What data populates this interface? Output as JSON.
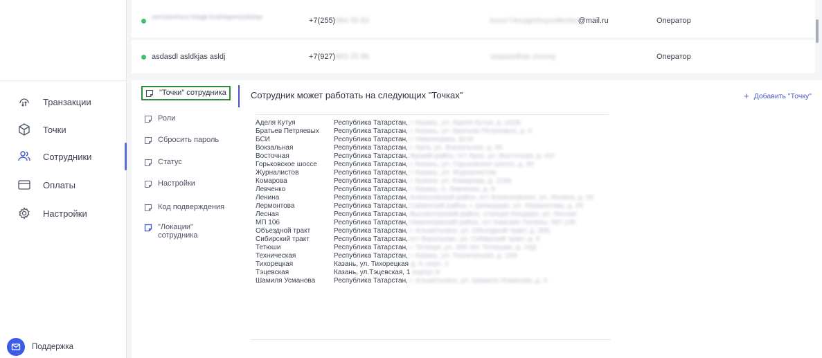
{
  "sidebar": {
    "items": [
      {
        "label": "Транзакции",
        "icon": "transactions-icon"
      },
      {
        "label": "Точки",
        "icon": "box-icon"
      },
      {
        "label": "Сотрудники",
        "icon": "users-icon"
      },
      {
        "label": "Оплаты",
        "icon": "payment-icon"
      },
      {
        "label": "Настройки",
        "icon": "gear-icon"
      }
    ],
    "active_index": 2,
    "support_label": "Поддержка"
  },
  "employees": [
    {
      "name": "yamxylumhwuu khtqgk Ecsjrhkgwmzyskickgc",
      "phone_prefix": "+7(255)",
      "phone_rest": "984 55 63",
      "email_hidden": "kxxvr74ncjqmhvyuntkmbo",
      "email_domain": "@mail.ru",
      "role": "Оператор"
    },
    {
      "name": "asdasdl asldkjas asldj",
      "phone_prefix": "+7(927)",
      "phone_rest": "863 25 86",
      "email_hidden": "ssaasodhac.mxsxq",
      "email_domain": "",
      "role": "Оператор"
    }
  ],
  "tabs": [
    {
      "label": "\"Точки\" сотрудника",
      "selected": true
    },
    {
      "label": "Роли"
    },
    {
      "label": "Сбросить пароль"
    },
    {
      "label": "Статус"
    },
    {
      "label": "Настройки"
    },
    {
      "label": "Код подверждения"
    },
    {
      "label": "\"Локации\" сотрудника"
    }
  ],
  "detail": {
    "title": "Сотрудник может работать на следующих \"Точках\"",
    "add_label": "Добавить \"Точку\""
  },
  "points": [
    {
      "name": "Аделя Кутуя",
      "address": "Республика Татарстан,",
      "hidden": "г. Казань, ул. Аделя Кутуя, д. 161В"
    },
    {
      "name": "Братьев Петряевых",
      "address": "Республика Татарстан,",
      "hidden": "г. Казань, ул. Братьев Петряевых, д. 5"
    },
    {
      "name": "БСИ",
      "address": "Республика Татарстан,",
      "hidden": "г. Нижнекамск, БСИ"
    },
    {
      "name": "Вокзальная",
      "address": "Республика Татарстан,",
      "hidden": "г. Арск, ул. Вокзальная, д. 90"
    },
    {
      "name": "Восточная",
      "address": "Республика Татарстан,",
      "hidden": "Арский район, пгт Арск, ул. Восточная, д. 41Г"
    },
    {
      "name": "Горьковское шоссе",
      "address": "Республика Татарстан,",
      "hidden": "г. Казань, ул. Горьковское шоссе, д. 30"
    },
    {
      "name": "Журналистов",
      "address": "Республика Татарстан,",
      "hidden": "г. Казань, ул. Журналистов"
    },
    {
      "name": "Комарова",
      "address": "Республика Татарстан,",
      "hidden": "г. Буинск, ул. Комарова, д. 115А"
    },
    {
      "name": "Левченко",
      "address": "Республика Татарстан,",
      "hidden": "г. Казань, п. Левченко, д. 9"
    },
    {
      "name": "Ленина",
      "address": "Республика Татарстан,",
      "hidden": "Алексеевский район, пгт Алексеевское, ул. Ленина, д. 50"
    },
    {
      "name": "Лермонтова",
      "address": "Республика Татарстан,",
      "hidden": "Сабинский район, г. Шемордан, ул. Лермонтова, д. 26"
    },
    {
      "name": "Лесная",
      "address": "Республика Татарстан,",
      "hidden": "Высокогорский район, станция Кендари, ул. Лесная"
    },
    {
      "name": "МП 106",
      "address": "Республика Татарстан,",
      "hidden": "Нижнекамский район, пгт Камские Поляны, МП 106"
    },
    {
      "name": "Объездной тракт",
      "address": "Республика Татарстан,",
      "hidden": "г. Альметьевск, ул. Объездной тракт, д. 35Б"
    },
    {
      "name": "Сибирский тракт",
      "address": "Республика Татарстан,",
      "hidden": "пгт Васильево, ул. Сибирский тракт, д. 6"
    },
    {
      "name": "Тетюши",
      "address": "Республика Татарстан,",
      "hidden": "г. Тетюши, ул. 200 лет Тетюшам, д. 14Д"
    },
    {
      "name": "Техническая",
      "address": "Республика Татарстан,",
      "hidden": "г. Казань, ул. Техническая, д. 15А"
    },
    {
      "name": "Тихорецкая",
      "address": "Казань, ул. Тихорецкая",
      "hidden": "д. 6, корп. 2"
    },
    {
      "name": "Тэцевская",
      "address": "Казань, ул.Тэцевская, 1",
      "hidden": "корпус 8"
    },
    {
      "name": "Шамиля Усманова",
      "address": "Республика Татарстан,",
      "hidden": "г. Альметьевск, ул. Шамиля Усманова, д. 3"
    }
  ],
  "colors": {
    "accent": "#3f56c9",
    "status_online": "#3ec06c",
    "selected_outline": "#2e8b3a",
    "support_button": "#3c5be6"
  }
}
